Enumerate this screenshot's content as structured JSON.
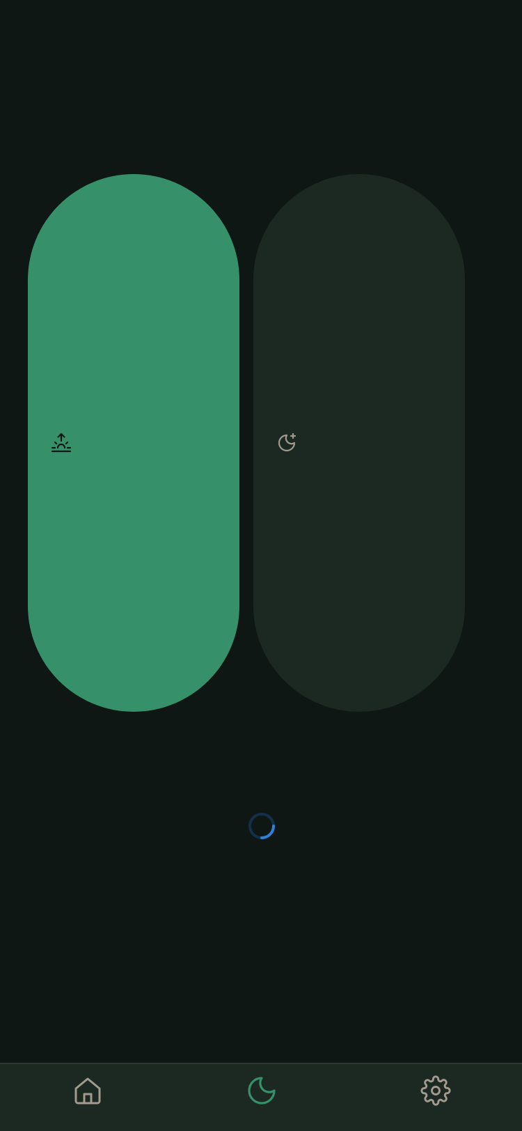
{
  "colors": {
    "background": "#0e1714",
    "wake_pill_active": "#36906a",
    "sleep_pill_inactive": "#1b2922",
    "nav_background": "#1b2922",
    "nav_inactive_icon": "#a29a8f",
    "nav_active_icon": "#36906a",
    "spinner_track": "#12304a",
    "spinner_arc": "#2f7fd8"
  },
  "toggles": [
    {
      "id": "wake",
      "icon": "sunrise-icon",
      "selected": true
    },
    {
      "id": "sleep",
      "icon": "moon-star-icon",
      "selected": false
    }
  ],
  "loading": {
    "icon": "loading-spinner",
    "visible": true
  },
  "bottom_nav": {
    "items": [
      {
        "id": "home",
        "icon": "home-icon",
        "active": false
      },
      {
        "id": "sleep",
        "icon": "moon-icon",
        "active": true
      },
      {
        "id": "settings",
        "icon": "gear-icon",
        "active": false
      }
    ]
  }
}
